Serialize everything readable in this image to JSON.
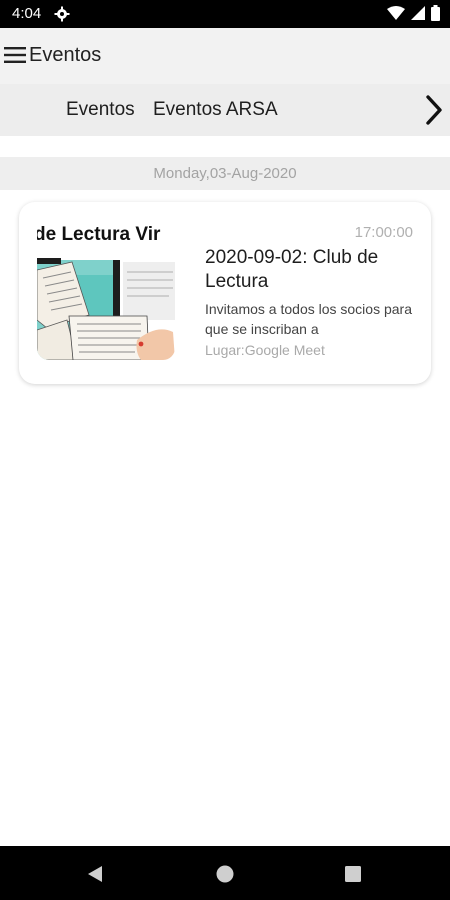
{
  "status": {
    "time": "4:04",
    "icons": [
      "settings-gear-icon",
      "wifi-icon",
      "cell-signal-icon",
      "battery-icon"
    ]
  },
  "app_bar": {
    "title": "Eventos",
    "menu_icon": "hamburger-menu-icon"
  },
  "tabs": {
    "items": [
      {
        "label": "Eventos"
      },
      {
        "label": "Eventos ARSA"
      }
    ],
    "next_icon": "chevron-right-icon"
  },
  "events": {
    "date_header": "Monday,03-Aug-2020",
    "items": [
      {
        "thumbnail_text": "de Lectura Vir",
        "time": "17:00:00",
        "title": "2020-09-02: Club de Lectura",
        "description": "Invitamos a todos los socios para que se inscriban a",
        "place": "Lugar:Google Meet"
      }
    ]
  },
  "nav": {
    "back_icon": "back-triangle-icon",
    "home_icon": "home-circle-icon",
    "recents_icon": "recents-square-icon"
  },
  "colors": {
    "status_bar": "#000000",
    "app_bar": "#f2f2f2",
    "tabs_bar": "#ededed",
    "date_header_bg": "#eeeeee",
    "muted_text": "#a3a3a3"
  }
}
